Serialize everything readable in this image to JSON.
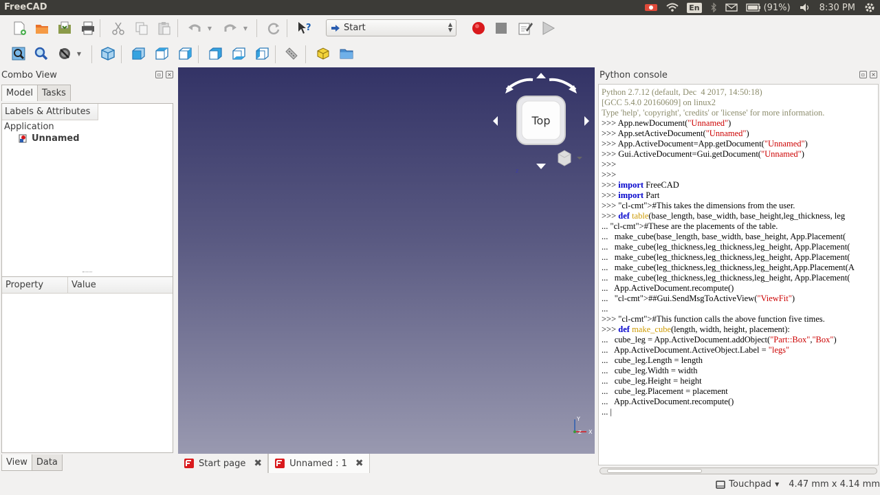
{
  "system": {
    "app_title": "FreeCAD",
    "lang": "En",
    "battery": "(91%)",
    "time": "8:30 PM"
  },
  "toolbar": {
    "workbench": "Start"
  },
  "combo": {
    "title": "Combo View",
    "tabs": [
      "Model",
      "Tasks"
    ],
    "tree_header": "Labels & Attributes",
    "app_label": "Application",
    "doc_label": "Unnamed",
    "prop_cols": [
      "Property",
      "Value"
    ],
    "bottom_tabs": [
      "View",
      "Data"
    ]
  },
  "view3d": {
    "navcube_face": "Top",
    "tabs": [
      "Start page",
      "Unnamed : 1"
    ]
  },
  "console": {
    "title": "Python console",
    "lines": [
      {
        "cls": "cl-gray",
        "text": "Python 2.7.12 (default, Dec  4 2017, 14:50:18)"
      },
      {
        "cls": "cl-gray",
        "text": "[GCC 5.4.0 20160609] on linux2"
      },
      {
        "cls": "cl-gray",
        "text": "Type 'help', 'copyright', 'credits' or 'license' for more information."
      },
      {
        "cls": "",
        "text": ">>> App.newDocument(\"Unnamed\")"
      },
      {
        "cls": "",
        "text": ">>> App.setActiveDocument(\"Unnamed\")"
      },
      {
        "cls": "",
        "text": ">>> App.ActiveDocument=App.getDocument(\"Unnamed\")"
      },
      {
        "cls": "",
        "text": ">>> Gui.ActiveDocument=Gui.getDocument(\"Unnamed\")"
      },
      {
        "cls": "",
        "text": ">>> "
      },
      {
        "cls": "",
        "text": ">>> "
      },
      {
        "cls": "",
        "text": ">>> import FreeCAD"
      },
      {
        "cls": "",
        "text": ">>> import Part"
      },
      {
        "cls": "",
        "text": ">>> #This takes the dimensions from the user."
      },
      {
        "cls": "",
        "text": ">>> def table(base_length, base_width, base_height,leg_thickness, leg"
      },
      {
        "cls": "",
        "text": "... #These are the placements of the table."
      },
      {
        "cls": "",
        "text": "...   make_cube(base_length, base_width, base_height, App.Placement("
      },
      {
        "cls": "",
        "text": "...   make_cube(leg_thickness,leg_thickness,leg_height, App.Placement("
      },
      {
        "cls": "",
        "text": "...   make_cube(leg_thickness,leg_thickness,leg_height, App.Placement("
      },
      {
        "cls": "",
        "text": "...   make_cube(leg_thickness,leg_thickness,leg_height,App.Placement(A"
      },
      {
        "cls": "",
        "text": "...   make_cube(leg_thickness,leg_thickness,leg_height, App.Placement("
      },
      {
        "cls": "",
        "text": "...   App.ActiveDocument.recompute()"
      },
      {
        "cls": "",
        "text": "...   ##Gui.SendMsgToActiveView(\"ViewFit\")"
      },
      {
        "cls": "",
        "text": "... "
      },
      {
        "cls": "",
        "text": ">>> #This function calls the above function five times."
      },
      {
        "cls": "",
        "text": ">>> def make_cube(length, width, height, placement):"
      },
      {
        "cls": "",
        "text": "...   cube_leg = App.ActiveDocument.addObject(\"Part::Box\",\"Box\")"
      },
      {
        "cls": "",
        "text": "...   App.ActiveDocument.ActiveObject.Label = \"legs\""
      },
      {
        "cls": "",
        "text": "...   cube_leg.Length = length"
      },
      {
        "cls": "",
        "text": "...   cube_leg.Width = width"
      },
      {
        "cls": "",
        "text": "...   cube_leg.Height = height"
      },
      {
        "cls": "",
        "text": "...   cube_leg.Placement = placement"
      },
      {
        "cls": "",
        "text": "...   App.ActiveDocument.recompute()"
      },
      {
        "cls": "",
        "text": "... |"
      }
    ]
  },
  "status": {
    "touchpad": "Touchpad",
    "dimensions": "4.47 mm x 4.14 mm"
  }
}
